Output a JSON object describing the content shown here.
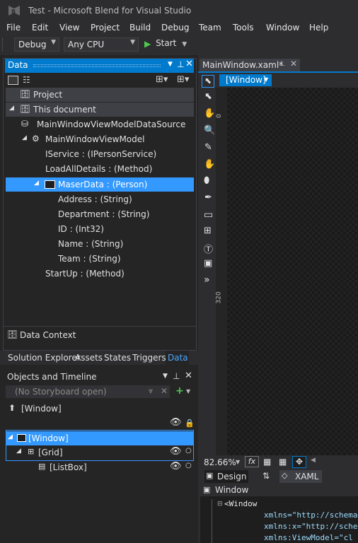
{
  "window": {
    "title": "Test - Microsoft Blend for Visual Studio"
  },
  "menu": [
    "File",
    "Edit",
    "View",
    "Project",
    "Build",
    "Debug",
    "Team",
    "Tools",
    "Window",
    "Help"
  ],
  "toolbar": {
    "config": "Debug",
    "platform": "Any CPU",
    "start_label": "Start"
  },
  "data_panel": {
    "title": "Data",
    "project_label": "Project",
    "this_document_label": "This document",
    "datasource": "MainWindowViewModelDataSource",
    "viewmodel": "MainWindowViewModel",
    "members": {
      "iservice": "IService : (IPersonService)",
      "loadall": "LoadAllDetails : (Method)",
      "maserdata": "MaserData : (Person)",
      "address": "Address : (String)",
      "department": "Department : (String)",
      "id": "ID : (Int32)",
      "name": "Name : (String)",
      "team": "Team : (String)",
      "startup": "StartUp : (Method)"
    },
    "data_context_label": "Data Context"
  },
  "bottom_tabs": [
    "Solution Explorer",
    "Assets",
    "States",
    "Triggers",
    "Data"
  ],
  "objects_panel": {
    "title": "Objects and Timeline",
    "storyboard_placeholder": "(No Storyboard open)",
    "scope": "[Window]",
    "tree": {
      "window": "[Window]",
      "grid": "[Grid]",
      "listbox": "[ListBox]"
    }
  },
  "document": {
    "tab_label": "MainWindow.xaml*",
    "breadcrumb": "[Window]",
    "ruler_top": "0",
    "ruler_mid": "320",
    "zoom": "82.66%",
    "fx": "fx",
    "design_tab": "Design",
    "xaml_tab": "XAML",
    "xaml_scope": "Window",
    "xaml_lines": {
      "l1": "<Window",
      "l2": "xmlns=\"http://schema",
      "l3": "xmlns:x=\"http://sche",
      "l4": "xmlns:ViewModel=\"cl"
    }
  },
  "colors": {
    "accent": "#007acc",
    "selection": "#3399ff",
    "background": "#1e1e1e",
    "chrome": "#2d2d30",
    "start_green": "#4ec94e"
  }
}
